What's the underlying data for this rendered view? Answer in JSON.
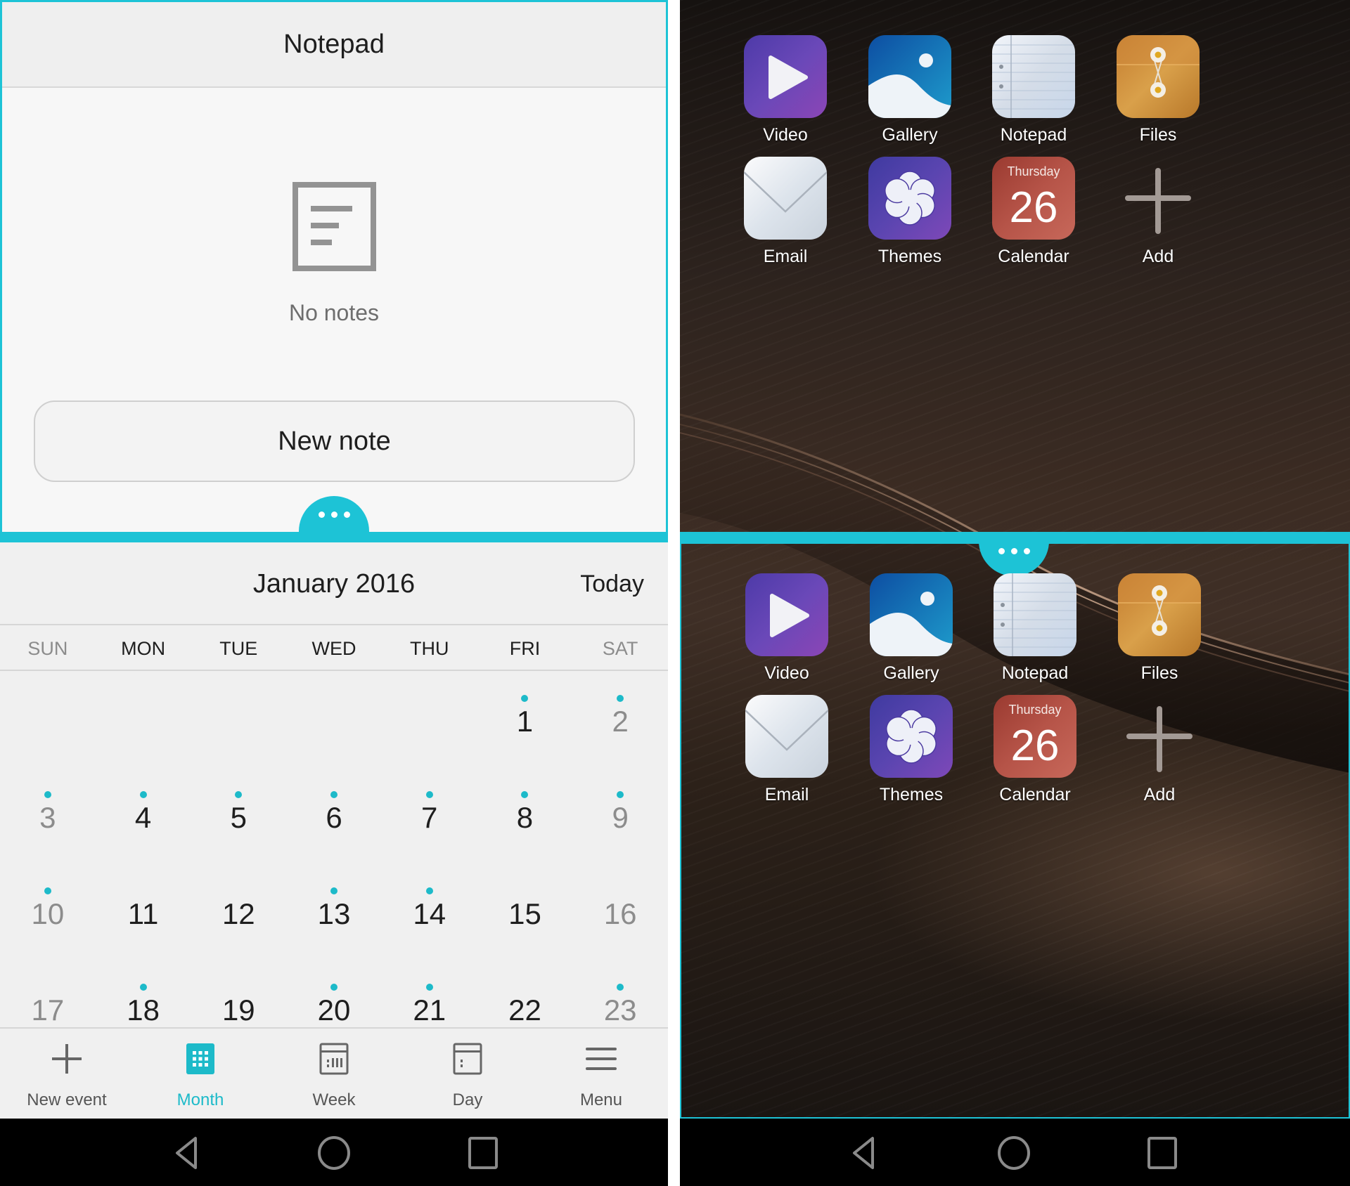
{
  "accent_color": "#1dc3d6",
  "notepad": {
    "title": "Notepad",
    "empty_text": "No notes",
    "new_note_label": "New note",
    "empty_icon": "note-document-icon"
  },
  "split_handle": {
    "icon": "more-dots-icon"
  },
  "calendar": {
    "month_title": "January 2016",
    "today_label": "Today",
    "weekdays": [
      "SUN",
      "MON",
      "TUE",
      "WED",
      "THU",
      "FRI",
      "SAT"
    ],
    "weeks": [
      [
        {
          "day": ""
        },
        {
          "day": ""
        },
        {
          "day": ""
        },
        {
          "day": ""
        },
        {
          "day": ""
        },
        {
          "day": "1",
          "event": true
        },
        {
          "day": "2",
          "event": true
        }
      ],
      [
        {
          "day": "3",
          "event": true
        },
        {
          "day": "4",
          "event": true
        },
        {
          "day": "5",
          "event": true
        },
        {
          "day": "6",
          "event": true
        },
        {
          "day": "7",
          "event": true
        },
        {
          "day": "8",
          "event": true
        },
        {
          "day": "9",
          "event": true
        }
      ],
      [
        {
          "day": "10",
          "event": true
        },
        {
          "day": "11",
          "event": false
        },
        {
          "day": "12",
          "event": false
        },
        {
          "day": "13",
          "event": true
        },
        {
          "day": "14",
          "event": true
        },
        {
          "day": "15",
          "event": false
        },
        {
          "day": "16",
          "event": false
        }
      ],
      [
        {
          "day": "17",
          "event": false
        },
        {
          "day": "18",
          "event": true
        },
        {
          "day": "19",
          "event": false
        },
        {
          "day": "20",
          "event": true
        },
        {
          "day": "21",
          "event": true
        },
        {
          "day": "22",
          "event": false
        },
        {
          "day": "23",
          "event": true
        }
      ]
    ],
    "toolbar": [
      {
        "label": "New event",
        "icon": "plus-icon",
        "active": false
      },
      {
        "label": "Month",
        "icon": "month-grid-icon",
        "active": true
      },
      {
        "label": "Week",
        "icon": "week-view-icon",
        "active": false
      },
      {
        "label": "Day",
        "icon": "day-view-icon",
        "active": false
      },
      {
        "label": "Menu",
        "icon": "menu-icon",
        "active": false
      }
    ]
  },
  "navbar": {
    "back": "back-icon",
    "home": "home-icon",
    "recents": "recents-icon"
  },
  "home_screen": {
    "apps": [
      {
        "label": "Video",
        "icon": "video-play-icon"
      },
      {
        "label": "Gallery",
        "icon": "gallery-icon"
      },
      {
        "label": "Notepad",
        "icon": "notepad-icon"
      },
      {
        "label": "Files",
        "icon": "files-folder-icon"
      },
      {
        "label": "Email",
        "icon": "email-envelope-icon"
      },
      {
        "label": "Themes",
        "icon": "themes-flower-icon"
      },
      {
        "label": "Calendar",
        "icon": "calendar-icon",
        "weekday": "Thursday",
        "date": "26"
      },
      {
        "label": "Add",
        "icon": "add-plus-icon"
      }
    ]
  }
}
